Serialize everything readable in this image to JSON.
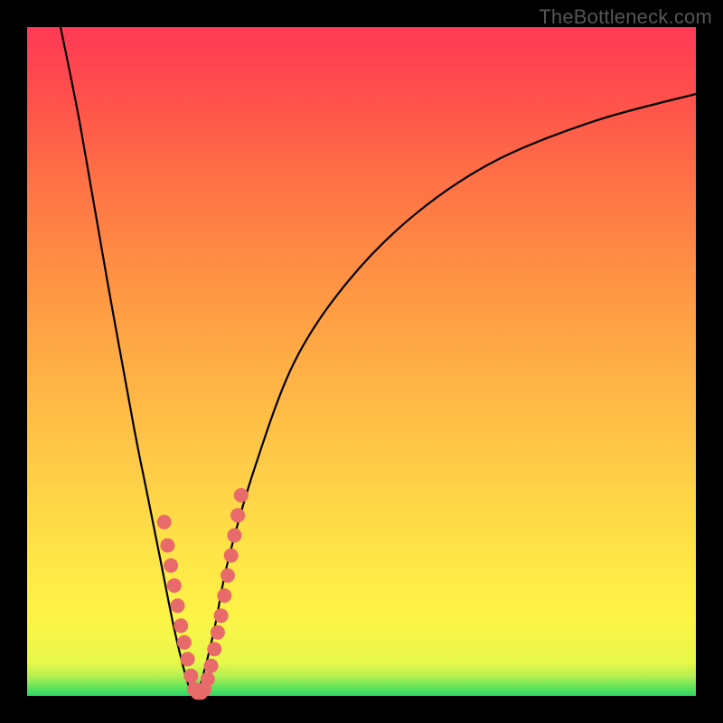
{
  "watermark": "TheBottleneck.com",
  "colors": {
    "background": "#000000",
    "gradient_top": "#ff3a55",
    "gradient_bottom": "#2bd965",
    "curve": "#000000",
    "markers": "#e86a6a"
  },
  "chart_data": {
    "type": "line",
    "title": "",
    "xlabel": "",
    "ylabel": "",
    "xlim": [
      0,
      100
    ],
    "ylim": [
      0,
      100
    ],
    "grid": false,
    "legend": false,
    "note": "V-shaped performance/bottleneck curve; minimum near x≈25; y rises steeply on both sides. No numeric axis ticks are shown in the image, so values are estimated on a 0–100 scale.",
    "series": [
      {
        "name": "bottleneck-curve",
        "x": [
          5,
          8,
          12,
          16,
          18,
          20,
          22,
          24,
          25,
          26,
          28,
          30,
          34,
          40,
          48,
          58,
          70,
          85,
          100
        ],
        "y": [
          100,
          85,
          62,
          40,
          30,
          20,
          10,
          2,
          0,
          2,
          10,
          20,
          34,
          50,
          62,
          72,
          80,
          86,
          90
        ]
      }
    ],
    "markers": {
      "name": "highlighted-points",
      "x": [
        20.5,
        21.0,
        21.5,
        22.0,
        22.5,
        23.0,
        23.5,
        24.0,
        24.5,
        25.0,
        25.5,
        26.0,
        26.5,
        27.0,
        27.5,
        28.0,
        28.5,
        29.0,
        29.5,
        30.0,
        30.5,
        31.0,
        31.5,
        32.0
      ],
      "y": [
        26.0,
        22.5,
        19.5,
        16.5,
        13.5,
        10.5,
        8.0,
        5.5,
        3.0,
        1.0,
        0.5,
        0.5,
        1.0,
        2.5,
        4.5,
        7.0,
        9.5,
        12.0,
        15.0,
        18.0,
        21.0,
        24.0,
        27.0,
        30.0
      ]
    }
  }
}
